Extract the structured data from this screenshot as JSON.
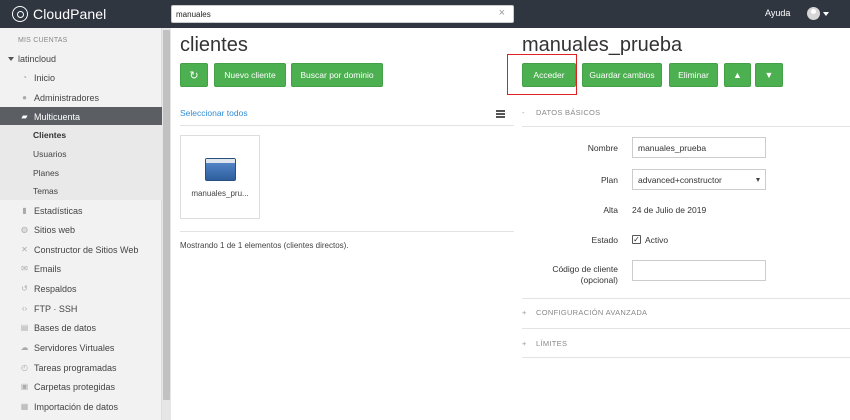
{
  "topbar": {
    "brand": "CloudPanel",
    "search_value": "manuales",
    "help": "Ayuda"
  },
  "sidebar": {
    "section": "MIS CUENTAS",
    "account": "latincloud",
    "items": [
      {
        "label": "Inicio",
        "icon": "dashboard-icon"
      },
      {
        "label": "Administradores",
        "icon": "users-icon"
      },
      {
        "label": "Multicuenta",
        "icon": "briefcase-icon",
        "active": true
      },
      {
        "label": "Estadísticas",
        "icon": "bar-chart-icon"
      },
      {
        "label": "Sitios web",
        "icon": "globe-icon"
      },
      {
        "label": "Constructor de Sitios Web",
        "icon": "tools-icon"
      },
      {
        "label": "Emails",
        "icon": "envelope-icon"
      },
      {
        "label": "Respaldos",
        "icon": "history-icon"
      },
      {
        "label": "FTP · SSH",
        "icon": "code-icon"
      },
      {
        "label": "Bases de datos",
        "icon": "database-icon"
      },
      {
        "label": "Servidores Virtuales",
        "icon": "server-icon"
      },
      {
        "label": "Tareas programadas",
        "icon": "clock-icon"
      },
      {
        "label": "Carpetas protegidas",
        "icon": "lock-icon"
      },
      {
        "label": "Importación de datos",
        "icon": "import-icon"
      }
    ],
    "subitems": [
      "Clientes",
      "Usuarios",
      "Planes",
      "Temas"
    ]
  },
  "clients": {
    "title": "clientes",
    "new_client": "Nuevo cliente",
    "search_domain": "Buscar por dominio",
    "select_all": "Seleccionar todos",
    "card_label": "manuales_pru...",
    "showing": "Mostrando 1 de 1 elementos (clientes directos)."
  },
  "detail": {
    "title": "manuales_prueba",
    "access": "Acceder",
    "save": "Guardar cambios",
    "delete": "Eliminar",
    "basic_section": "DATOS BÁSICOS",
    "basic_sign": "-",
    "name_label": "Nombre",
    "name_value": "manuales_prueba",
    "plan_label": "Plan",
    "plan_value": "advanced+constructor",
    "date_label": "Alta",
    "date_value": "24 de Julio de 2019",
    "status_label": "Estado",
    "status_value": "Activo",
    "status_checked": true,
    "code_label_1": "Código de cliente",
    "code_label_2": "(opcional)",
    "code_value": "",
    "advanced_section": "CONFIGURACIÓN AVANZADA",
    "advanced_sign": "+",
    "limits_section": "LÍMITES",
    "limits_sign": "+"
  },
  "colors": {
    "topbar": "#2f3640",
    "primary_button": "#4caf50",
    "link": "#2f8bd6",
    "sidebar_active": "#5b5f64",
    "highlight": "#e02020"
  }
}
